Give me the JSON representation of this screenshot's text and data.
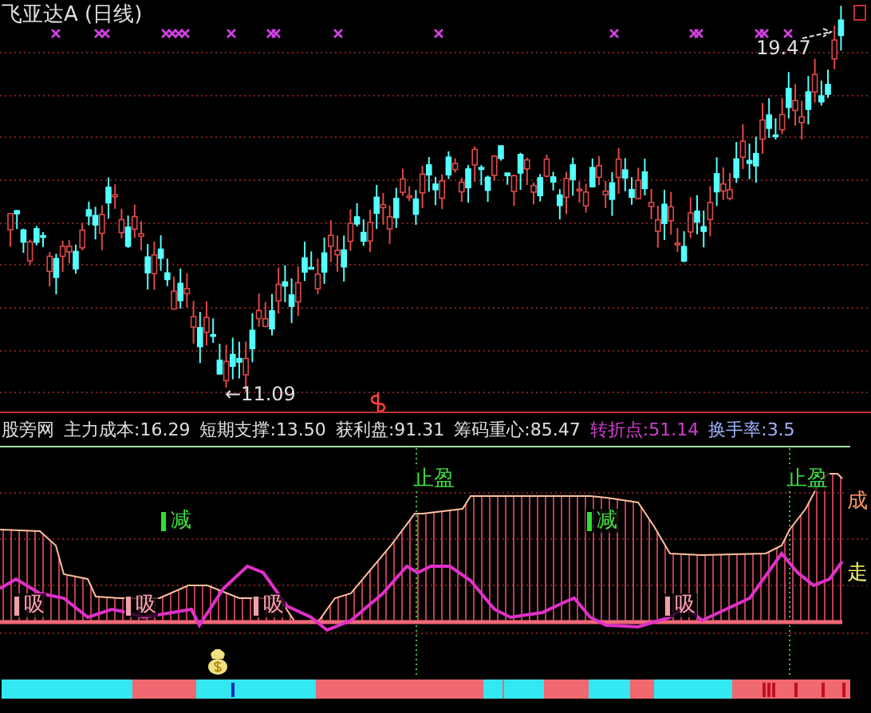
{
  "main_chart": {
    "title": "飞亚达A (日线)",
    "high_label": "19.47",
    "low_label": "←11.09"
  },
  "indicator_header": [
    {
      "label": "股旁网",
      "color": "#e0e0e0"
    },
    {
      "label": "主力成本:",
      "value": "16.29",
      "color": "#e0e0e0"
    },
    {
      "label": "短期支撑:",
      "value": "13.50",
      "color": "#e0e0e0"
    },
    {
      "label": "获利盘:",
      "value": "91.31",
      "color": "#e0e0e0"
    },
    {
      "label": "筹码重心:",
      "value": "85.47",
      "color": "#e0e0e0"
    },
    {
      "label": "转折点:",
      "value": "51.14",
      "color": "#d040d0"
    },
    {
      "label": "换手率:",
      "value": "3.5",
      "color": "#9fb4ff"
    }
  ],
  "signals": [
    {
      "kind": "stop",
      "label": "止盈"
    },
    {
      "kind": "stop",
      "label": "止盈"
    },
    {
      "kind": "reduce",
      "label": "减"
    },
    {
      "kind": "reduce",
      "label": "减"
    },
    {
      "kind": "absorb",
      "label": "吸"
    },
    {
      "kind": "absorb",
      "label": "吸"
    },
    {
      "kind": "absorb",
      "label": "吸"
    },
    {
      "kind": "absorb",
      "label": "吸"
    },
    {
      "kind": "line",
      "label": "成",
      "color": "#ff9966"
    },
    {
      "kind": "line",
      "label": "走",
      "color": "#ffff66"
    }
  ]
}
